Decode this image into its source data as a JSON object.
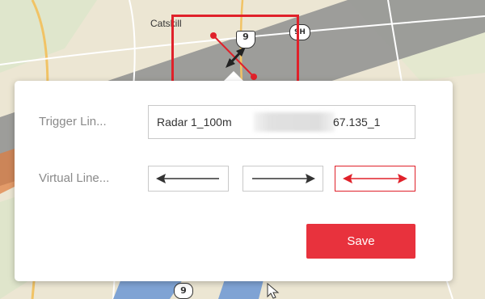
{
  "map": {
    "place_label": "Catskill",
    "route_shield_1": "9",
    "route_shield_2": "9H",
    "route_shield_3": "9"
  },
  "dialog": {
    "trigger_label": "Trigger Lin...",
    "trigger_value": "Radar 1_100m",
    "trigger_value_suffix": "67.135_1",
    "virtual_label": "Virtual Line...",
    "directions": [
      {
        "name": "left-arrow",
        "active": false
      },
      {
        "name": "right-arrow",
        "active": false
      },
      {
        "name": "both-arrows",
        "active": true
      }
    ],
    "save_label": "Save"
  },
  "colors": {
    "accent": "#e0212a",
    "save_button": "#e8323d"
  }
}
